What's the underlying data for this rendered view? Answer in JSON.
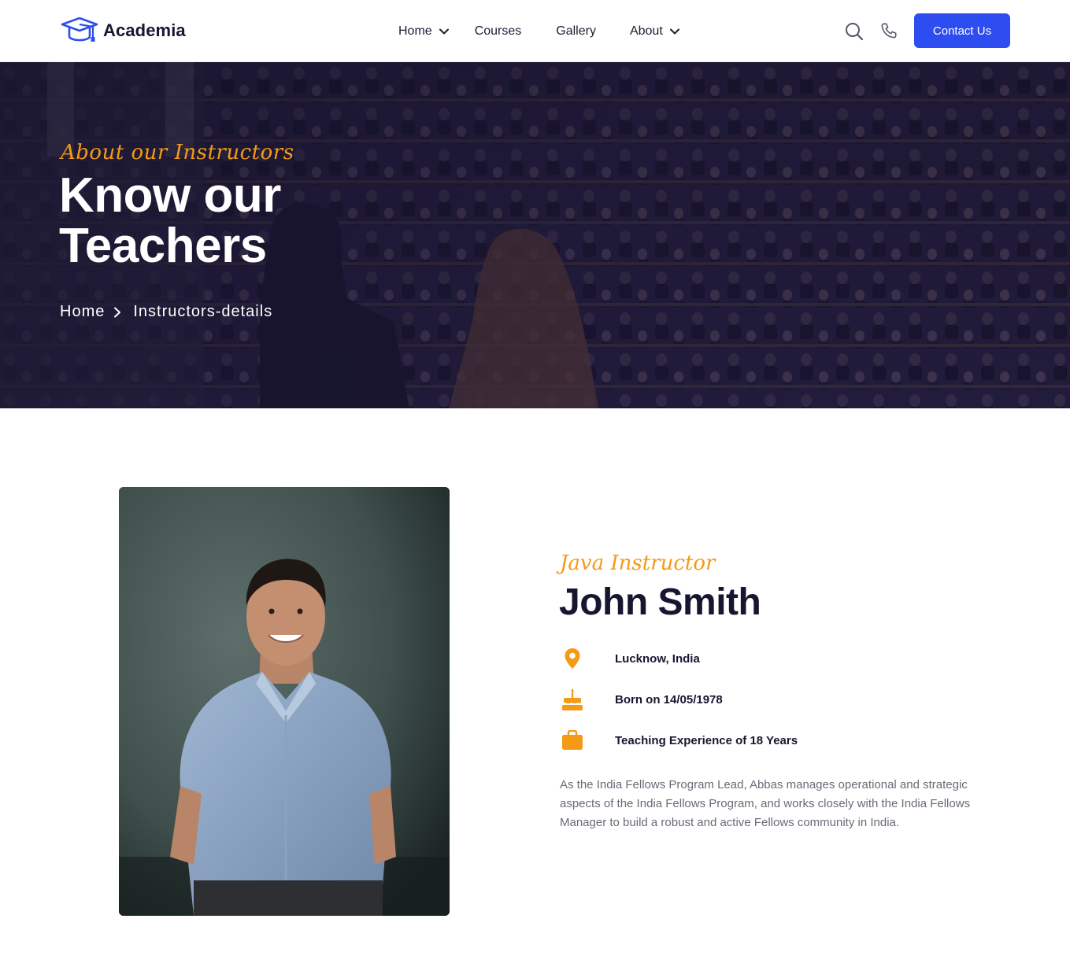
{
  "header": {
    "logo_text": "Academia",
    "nav": [
      {
        "label": "Home"
      },
      {
        "label": "Courses"
      },
      {
        "label": "Gallery"
      },
      {
        "label": "About"
      }
    ],
    "contact_label": "Contact Us",
    "icons": [
      "graduation-cap-icon",
      "search-icon",
      "phone-icon",
      "chevron-down-icon"
    ]
  },
  "hero": {
    "eyebrow": "About our Instructors",
    "title": "Know our Teachers",
    "breadcrumb": {
      "home": "Home",
      "current": "Instructors-details"
    }
  },
  "profile": {
    "role": "Java Instructor",
    "name": "John Smith",
    "facts": [
      {
        "icon": "location-pin-icon",
        "text": "Lucknow, India"
      },
      {
        "icon": "birthday-cake-icon",
        "text": "Born on 14/05/1978"
      },
      {
        "icon": "briefcase-icon",
        "text": "Teaching Experience of 18 Years"
      }
    ],
    "bio": "As the India Fellows Program Lead, Abbas manages operational and strategic aspects of the India Fellows Program, and works closely with the India Fellows Manager to build a robust and active Fellows community in India."
  },
  "colors": {
    "primary": "#2e4df0",
    "accent": "#f59a17",
    "heading": "#161630",
    "body_text": "#6a6a78",
    "hero_bg": "#1d1a34"
  }
}
